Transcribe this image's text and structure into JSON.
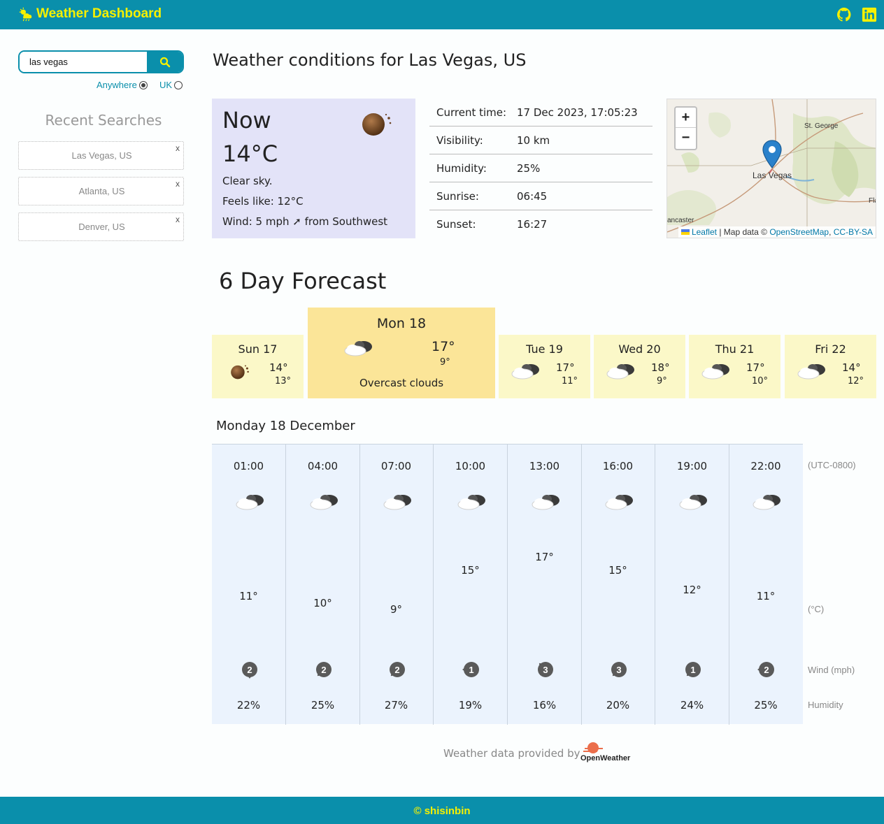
{
  "header": {
    "title": "Weather Dashboard",
    "github_icon": "github-icon",
    "linkedin_icon": "linkedin-icon",
    "bg_color": "#0a8fab",
    "accent_color": "#f6f000"
  },
  "sidebar": {
    "search": {
      "value": "las vegas"
    },
    "scope": {
      "anywhere_label": "Anywhere",
      "uk_label": "UK",
      "selected": "Anywhere"
    },
    "recent_title": "Recent Searches",
    "recent": [
      {
        "label": "Las Vegas, US",
        "remove": "x"
      },
      {
        "label": "Atlanta, US",
        "remove": "x"
      },
      {
        "label": "Denver, US",
        "remove": "x"
      }
    ]
  },
  "main": {
    "title": "Weather conditions for Las Vegas, US",
    "now": {
      "label": "Now",
      "temp": "14°C",
      "description": "Clear sky.",
      "feels_like": "Feels like: 12°C",
      "wind": "Wind: 5 mph ➚ from Southwest"
    },
    "details": [
      {
        "key": "Current time:",
        "value": "17 Dec 2023, 17:05:23"
      },
      {
        "key": "Visibility:",
        "value": "10 km"
      },
      {
        "key": "Humidity:",
        "value": "25%"
      },
      {
        "key": "Sunrise:",
        "value": "06:45"
      },
      {
        "key": "Sunset:",
        "value": "16:27"
      }
    ],
    "map": {
      "zoom_in": "+",
      "zoom_out": "−",
      "marker_label": "Las Vegas",
      "place_st_george": "St. George",
      "place_lancaster": "ancaster",
      "place_fla": "Fla",
      "attr_leaflet": "Leaflet",
      "attr_mid": "| Map data ©",
      "attr_osm": "OpenStreetMap",
      "attr_sep": ",",
      "attr_license": "CC-BY-SA"
    },
    "forecast": {
      "title": "6 Day Forecast",
      "days": [
        {
          "name": "Sun 17",
          "hi": "14°",
          "lo": "13°",
          "icon": "clear-night-icon"
        },
        {
          "name": "Mon 18",
          "hi": "17°",
          "lo": "9°",
          "icon": "overcast-clouds-icon",
          "description": "Overcast clouds"
        },
        {
          "name": "Tue 19",
          "hi": "17°",
          "lo": "11°",
          "icon": "overcast-clouds-icon"
        },
        {
          "name": "Wed 20",
          "hi": "18°",
          "lo": "9°",
          "icon": "overcast-clouds-icon"
        },
        {
          "name": "Thu 21",
          "hi": "17°",
          "lo": "10°",
          "icon": "overcast-clouds-icon"
        },
        {
          "name": "Fri 22",
          "hi": "14°",
          "lo": "12°",
          "icon": "overcast-clouds-icon"
        }
      ],
      "selected_day": "Mon 18"
    },
    "hourly": {
      "heading": "Monday 18 December",
      "timezone": "(UTC-0800)",
      "temp_unit": "(°C)",
      "wind_unit": "Wind (mph)",
      "humidity_label": "Humidity",
      "hours": [
        {
          "time": "01:00",
          "temp": "11°",
          "wind": "2",
          "wind_dir": "S",
          "humidity": "22%"
        },
        {
          "time": "04:00",
          "temp": "10°",
          "wind": "2",
          "wind_dir": "SW",
          "humidity": "25%"
        },
        {
          "time": "07:00",
          "temp": "9°",
          "wind": "2",
          "wind_dir": "SW",
          "humidity": "27%"
        },
        {
          "time": "10:00",
          "temp": "15°",
          "wind": "1",
          "wind_dir": "W",
          "humidity": "19%"
        },
        {
          "time": "13:00",
          "temp": "17°",
          "wind": "3",
          "wind_dir": "NW",
          "humidity": "16%"
        },
        {
          "time": "16:00",
          "temp": "15°",
          "wind": "3",
          "wind_dir": "SW",
          "humidity": "20%"
        },
        {
          "time": "19:00",
          "temp": "12°",
          "wind": "1",
          "wind_dir": "SW",
          "humidity": "24%"
        },
        {
          "time": "22:00",
          "temp": "11°",
          "wind": "2",
          "wind_dir": "W",
          "humidity": "25%"
        }
      ]
    },
    "credit": {
      "text": "Weather data provided by",
      "logo_text": "OpenWeather"
    }
  },
  "footer": {
    "text": "© shisinbin"
  }
}
